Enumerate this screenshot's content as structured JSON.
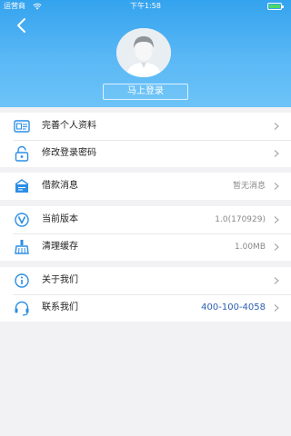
{
  "status_bar": {
    "carrier": "运营商",
    "time": "下午1:58"
  },
  "header": {
    "login_label": "马上登录"
  },
  "groups": [
    {
      "items": [
        {
          "label": "完善个人资料",
          "icon": "id-card-icon"
        },
        {
          "label": "修改登录密码",
          "icon": "lock-icon"
        }
      ]
    },
    {
      "items": [
        {
          "label": "借款消息",
          "value": "暂无消息",
          "icon": "message-box-icon"
        }
      ]
    },
    {
      "items": [
        {
          "label": "当前版本",
          "value": "1.0(170929)",
          "icon": "version-v-icon"
        },
        {
          "label": "清理缓存",
          "value": "1.00MB",
          "icon": "broom-icon"
        }
      ]
    },
    {
      "items": [
        {
          "label": "关于我们",
          "icon": "info-icon"
        },
        {
          "label": "联系我们",
          "value": "400-100-4058",
          "icon": "headset-icon"
        }
      ]
    }
  ],
  "colors": {
    "accent": "#3a9ef0",
    "header_top": "#34a3ee",
    "header_bottom": "#6cc3f7",
    "phone_text": "#2a5fb0",
    "background": "#f2f2f4"
  }
}
